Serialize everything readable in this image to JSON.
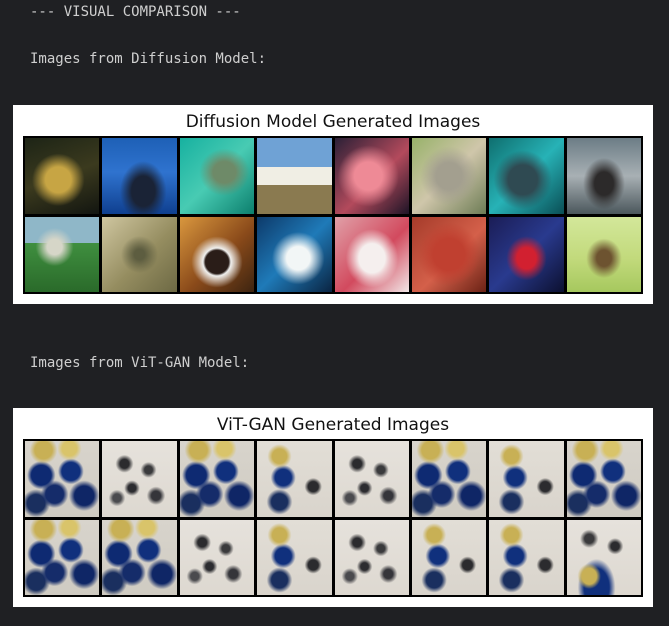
{
  "output": {
    "visual_comparison": "--- VISUAL COMPARISON ---",
    "diffusion_intro": "Images from Diffusion Model:",
    "vitgan_intro": "Images from ViT-GAN Model:"
  },
  "figures": {
    "diffusion": {
      "title": "Diffusion Model Generated Images",
      "rows": 2,
      "cols": 8
    },
    "vitgan": {
      "title": "ViT-GAN Generated Images",
      "rows": 2,
      "cols": 8
    }
  },
  "colors": {
    "background": "#1f2023",
    "output_text": "#cfcfcf",
    "figure_background": "#ffffff"
  }
}
